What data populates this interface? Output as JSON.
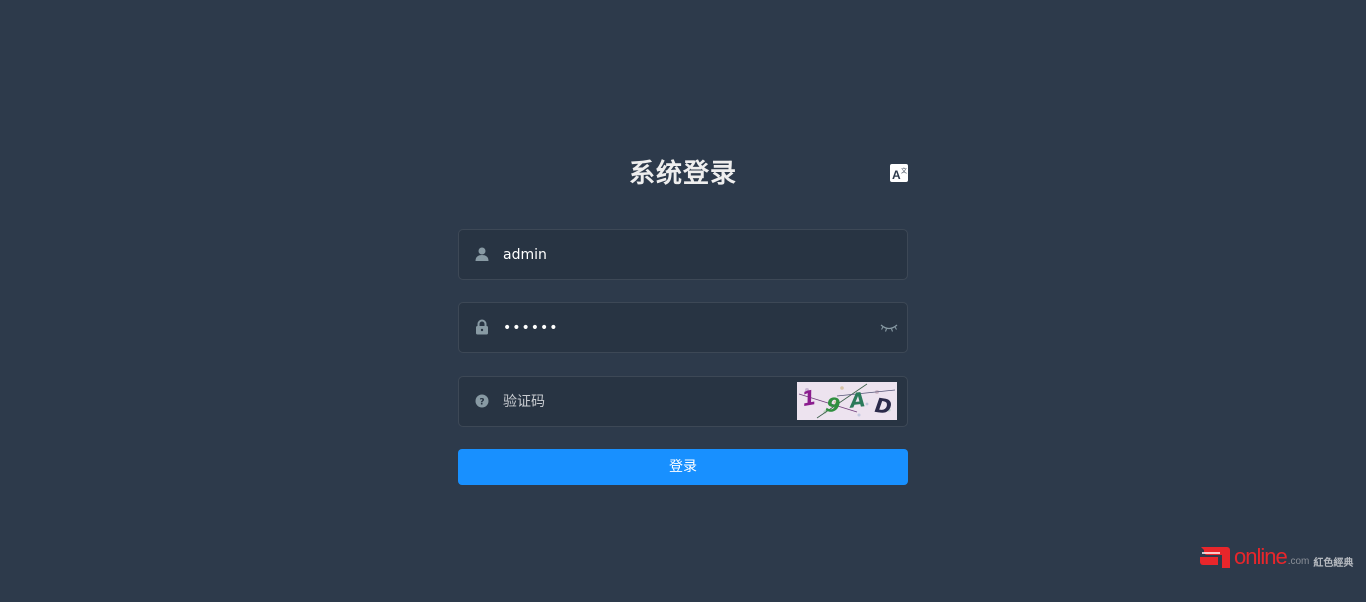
{
  "title": "系统登录",
  "lang_icon": "translate-icon",
  "form": {
    "username": {
      "icon": "user-icon",
      "value": "admin",
      "placeholder": ""
    },
    "password": {
      "icon": "lock-icon",
      "value": "123456",
      "placeholder": "",
      "toggle_icon": "eye-closed-icon"
    },
    "captcha": {
      "icon": "question-circle-icon",
      "value": "",
      "placeholder": "验证码",
      "image_text": [
        "1",
        "9",
        "A",
        "D"
      ]
    }
  },
  "login_button": "登录",
  "watermark": {
    "brand": "online",
    "suffix": ".com",
    "cn": "紅色經典"
  },
  "colors": {
    "background": "#2d3a4b",
    "input_bg": "#283443",
    "accent": "#1890ff",
    "title": "#eeeeee"
  }
}
